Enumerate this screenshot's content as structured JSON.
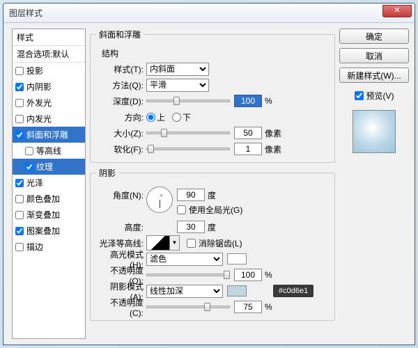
{
  "window": {
    "title": "图层样式",
    "close": "✕"
  },
  "styles": {
    "header": "样式",
    "blend": "混合选项:默认",
    "items": [
      {
        "label": "投影",
        "checked": false
      },
      {
        "label": "内阴影",
        "checked": true
      },
      {
        "label": "外发光",
        "checked": false
      },
      {
        "label": "内发光",
        "checked": false
      },
      {
        "label": "斜面和浮雕",
        "checked": true,
        "selected": true
      },
      {
        "label": "等高线",
        "checked": false,
        "sub": true
      },
      {
        "label": "纹理",
        "checked": true,
        "sub": true,
        "subselected": true
      },
      {
        "label": "光泽",
        "checked": true
      },
      {
        "label": "颜色叠加",
        "checked": false
      },
      {
        "label": "渐变叠加",
        "checked": false
      },
      {
        "label": "图案叠加",
        "checked": true
      },
      {
        "label": "描边",
        "checked": false
      }
    ]
  },
  "bevel": {
    "title": "斜面和浮雕",
    "structure": "结构",
    "style_label": "样式(T):",
    "style_value": "内斜面",
    "technique_label": "方法(Q):",
    "technique_value": "平滑",
    "depth_label": "深度(D):",
    "depth_value": "100",
    "depth_unit": "%",
    "direction_label": "方向:",
    "up": "上",
    "down": "下",
    "size_label": "大小(Z):",
    "size_value": "50",
    "size_unit": "像素",
    "soften_label": "软化(F):",
    "soften_value": "1",
    "soften_unit": "像素"
  },
  "shading": {
    "title": "阴影",
    "angle_label": "角度(N):",
    "angle_value": "90",
    "deg": "度",
    "global_label": "使用全局光(G)",
    "altitude_label": "高度:",
    "altitude_value": "30",
    "gloss_label": "光泽等高线:",
    "antialias_label": "消除锯齿(L)",
    "highlight_mode_label": "高光模式(H):",
    "highlight_mode_value": "滤色",
    "hl_opacity_label": "不透明度(O):",
    "hl_opacity_value": "100",
    "pct": "%",
    "shadow_mode_label": "阴影模式(A):",
    "shadow_mode_value": "线性加深",
    "sh_opacity_label": "不透明度(C):",
    "sh_opacity_value": "75",
    "swatch_tip": "#c0d6e1"
  },
  "right": {
    "ok": "确定",
    "cancel": "取消",
    "newstyle": "新建样式(W)...",
    "preview": "预览(V)"
  }
}
